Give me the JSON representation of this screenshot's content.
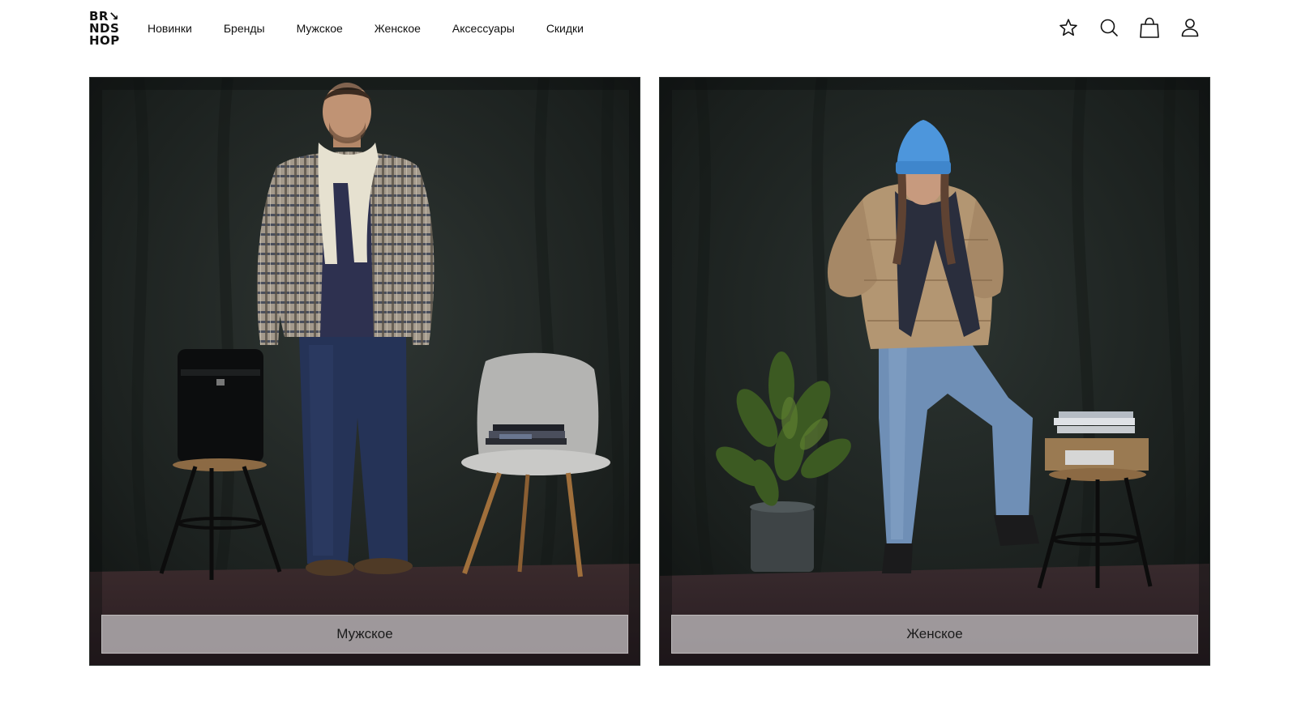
{
  "logo": {
    "line1": "BR↘",
    "line2": "NDS",
    "line3": "HOP"
  },
  "nav": [
    {
      "label": "Новинки"
    },
    {
      "label": "Бренды"
    },
    {
      "label": "Мужское"
    },
    {
      "label": "Женское"
    },
    {
      "label": "Аксессуары"
    },
    {
      "label": "Скидки"
    }
  ],
  "header_icons": [
    "star-icon",
    "search-icon",
    "bag-icon",
    "user-icon"
  ],
  "cards": [
    {
      "button_label": "Мужское"
    },
    {
      "button_label": "Женское"
    }
  ],
  "colors": {
    "background": "#ffffff",
    "text": "#111111",
    "card_dark": "#1e2321",
    "button_overlay": "#bebabc"
  }
}
